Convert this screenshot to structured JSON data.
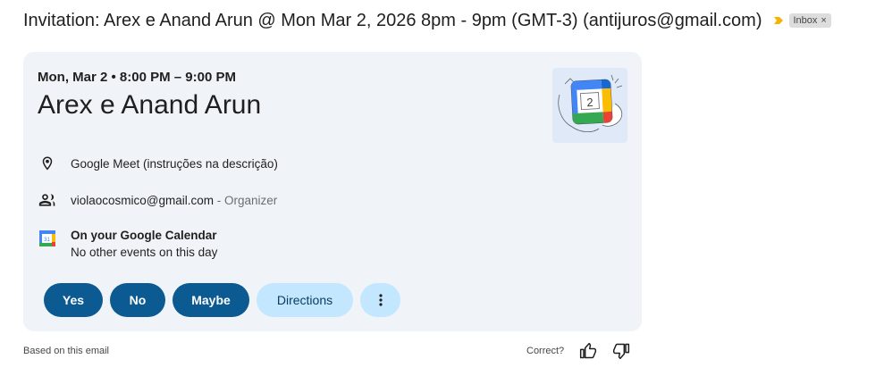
{
  "email": {
    "subject": "Invitation: Arex e Anand Arun @ Mon Mar 2, 2026 8pm - 9pm (GMT-3) (antijuros@gmail.com)",
    "label": "Inbox",
    "label_remove": "×"
  },
  "event": {
    "when": "Mon, Mar 2 • 8:00 PM – 9:00 PM",
    "title": "Arex e Anand Arun",
    "calendar_day": "2",
    "calendar_mini_day": "31",
    "location": "Google Meet (instruções na descrição)",
    "organizer_email": "violaocosmico@gmail.com",
    "organizer_role": " - Organizer",
    "calendar_title": "On your Google Calendar",
    "calendar_status": "No other events on this day"
  },
  "actions": {
    "yes": "Yes",
    "no": "No",
    "maybe": "Maybe",
    "directions": "Directions"
  },
  "footer": {
    "based_on": "Based on this email",
    "correct": "Correct?"
  },
  "colors": {
    "card_bg": "#f0f4f9",
    "primary_button": "#0b5a91",
    "secondary_button": "#c2e7ff",
    "importance_marker": "#f4b400"
  },
  "icons": [
    "importance-marker-icon",
    "location-pin-icon",
    "people-icon",
    "google-calendar-icon",
    "more-vert-icon",
    "thumbs-up-icon",
    "thumbs-down-icon"
  ]
}
